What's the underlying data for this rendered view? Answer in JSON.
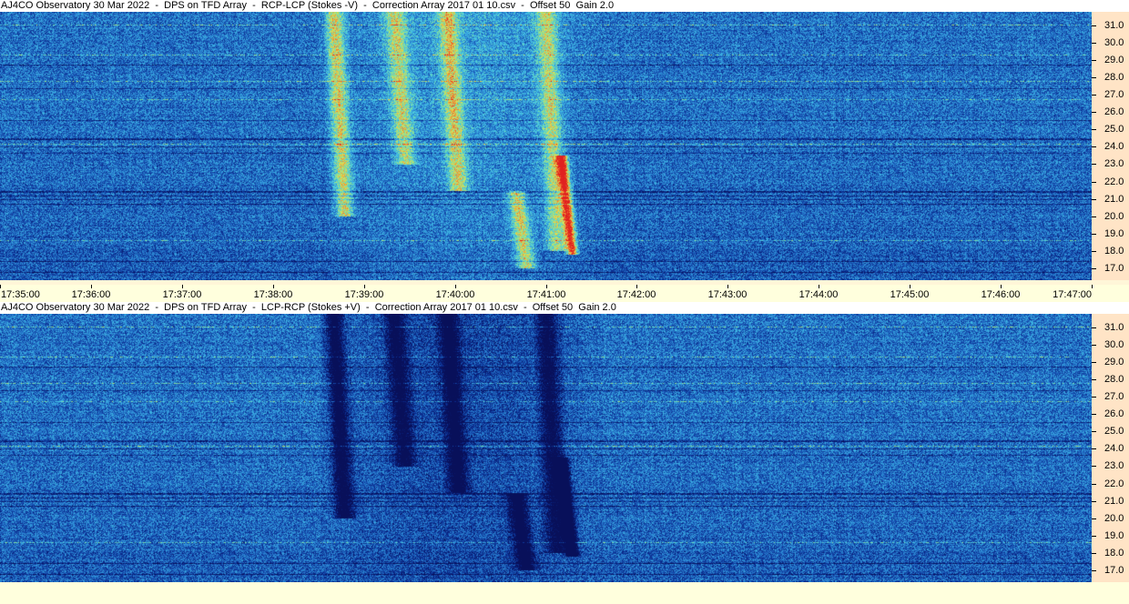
{
  "panels": [
    {
      "title": "AJ4CO Observatory 30 Mar 2022  -  DPS on TFD Array  -  RCP-LCP (Stokes -V)  -  Correction Array 2017 01 10.csv  -  Offset 50  Gain 2.0",
      "polarity": "bright"
    },
    {
      "title": "AJ4CO Observatory 30 Mar 2022  -  DPS on TFD Array  -  LCP-RCP (Stokes +V)  -  Correction Array 2017 01 10.csv  -  Offset 50  Gain 2.0",
      "polarity": "dark"
    }
  ],
  "chart_data": {
    "type": "heatmap",
    "time_ticks": [
      "17:35:00",
      "17:36:00",
      "17:37:00",
      "17:38:00",
      "17:39:00",
      "17:40:00",
      "17:41:00",
      "17:42:00",
      "17:43:00",
      "17:44:00",
      "17:45:00",
      "17:46:00",
      "17:47:00"
    ],
    "freq_ticks": [
      "31.0",
      "30.0",
      "29.0",
      "28.0",
      "27.0",
      "26.0",
      "25.0",
      "24.0",
      "23.0",
      "22.0",
      "21.0",
      "20.0",
      "19.0",
      "18.0",
      "17.0"
    ],
    "x_range": [
      "17:35:00",
      "17:47:00"
    ],
    "y_range": [
      16.3,
      31.8
    ],
    "colormap": [
      "#08105a",
      "#0a2a8c",
      "#1a5ab8",
      "#2f8fd8",
      "#45c6e6",
      "#7fe0a0",
      "#e0e050",
      "#f08030",
      "#e02020"
    ],
    "bursts": [
      {
        "time": "17:38:40",
        "freq_low": 20.0,
        "freq_high": 31.8,
        "strength": 0.6
      },
      {
        "time": "17:39:20",
        "freq_low": 23.0,
        "freq_high": 31.8,
        "strength": 0.5
      },
      {
        "time": "17:39:55",
        "freq_low": 21.5,
        "freq_high": 31.8,
        "strength": 0.55
      },
      {
        "time": "17:40:40",
        "freq_low": 17.0,
        "freq_high": 21.5,
        "strength": 0.6
      },
      {
        "time": "17:41:00",
        "freq_low": 18.0,
        "freq_high": 31.8,
        "strength": 0.5
      },
      {
        "time": "17:41:10",
        "freq_low": 17.8,
        "freq_high": 23.5,
        "strength": 1.0
      }
    ]
  }
}
